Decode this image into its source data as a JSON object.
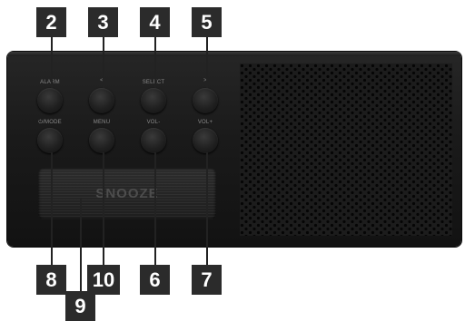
{
  "callouts": {
    "c2": "2",
    "c3": "3",
    "c4": "4",
    "c5": "5",
    "c8": "8",
    "c10": "10",
    "c6": "6",
    "c7": "7",
    "c9": "9"
  },
  "buttons": {
    "top": {
      "alarm": "ALARM",
      "prev": "<",
      "select": "SELECT",
      "next": ">"
    },
    "bottom": {
      "power_mode": "⏻/MODE",
      "menu": "MENU",
      "vol_down": "VOL-",
      "vol_up": "VOL+"
    }
  },
  "snooze": {
    "label": "SNOOZE"
  },
  "colors": {
    "callout_bg": "#2b2b2b",
    "callout_text": "#ffffff",
    "device_body": "#1a1a1a"
  },
  "icons": {
    "power": "power-icon"
  }
}
